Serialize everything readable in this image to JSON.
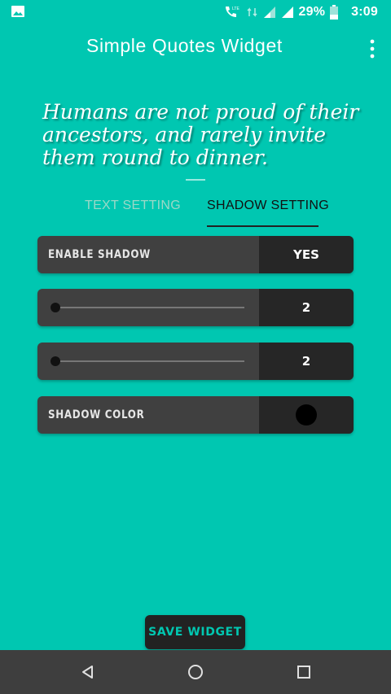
{
  "status_bar": {
    "network_label": "LTE",
    "battery_percent": "29%",
    "time": "3:09",
    "icons": [
      "image-icon",
      "call-lte-icon",
      "data-arrows-icon",
      "signal-icon",
      "signal-icon",
      "battery-icon"
    ]
  },
  "app_bar": {
    "title": "Simple Quotes Widget",
    "overflow_icon": "more-vert-icon"
  },
  "quote": {
    "text": "Humans are not proud of their ancestors, and rarely invite them round to dinner."
  },
  "tabs": [
    {
      "label": "TEXT SETTING",
      "selected": false
    },
    {
      "label": "SHADOW SETTING",
      "selected": true
    }
  ],
  "settings": {
    "enable_shadow": {
      "label": "ENABLE SHADOW",
      "value": "YES"
    },
    "shadow_radius": {
      "value": "2",
      "slider_fraction": 0.0
    },
    "shadow_offset": {
      "value": "2",
      "slider_fraction": 0.0
    },
    "shadow_color": {
      "label": "SHADOW COLOR",
      "color": "#000000"
    }
  },
  "save_button": {
    "label": "SAVE WIDGET"
  },
  "nav_bar": {
    "icons": [
      "back-icon",
      "home-icon",
      "recents-icon"
    ]
  },
  "colors": {
    "accent": "#00C7B1",
    "row_bg": "#404040",
    "value_bg": "#262626"
  }
}
